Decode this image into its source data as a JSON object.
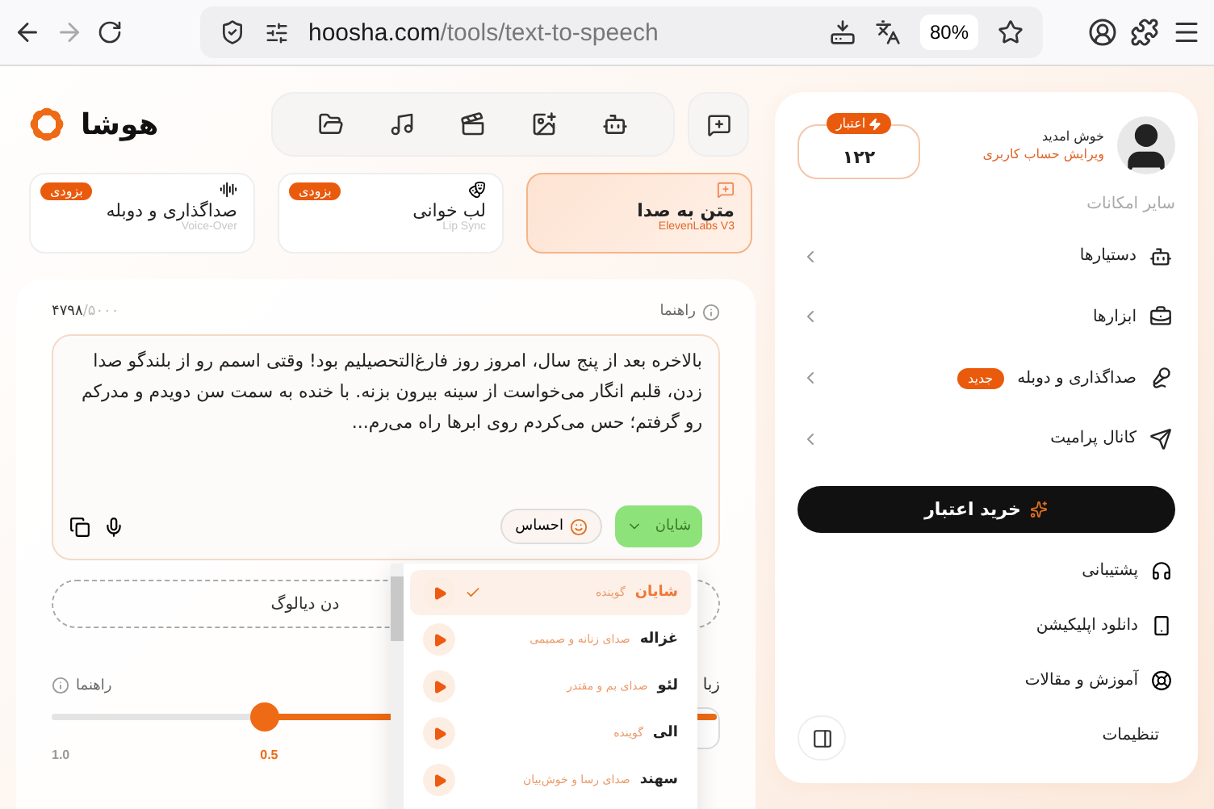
{
  "browser": {
    "url_host": "hoosha.com",
    "url_path": "/tools/text-to-speech",
    "zoom": "80%"
  },
  "logo": {
    "text": "هوشا"
  },
  "mode_cards": [
    {
      "title": "متن به صدا",
      "subtitle": "ElevenLabs V3",
      "selected": true
    },
    {
      "title": "لب خوانی",
      "subtitle": "Lip Sync",
      "badge": "بزودی",
      "selected": false
    },
    {
      "title": "صداگذاری و دوبله",
      "subtitle": "Voice-Over",
      "badge": "بزودی",
      "selected": false
    }
  ],
  "editor": {
    "guide": "راهنما",
    "counter_used": "۴۷۹۸",
    "counter_max": "/۵۰۰۰",
    "text": "بالاخره بعد از پنج سال، امروز روز فارغ‌التحصیلیم بود! وقتی اسمم رو از بلندگو صدا زدن، قلبم انگار می‌خواست از سینه بیرون بزنه. با خنده به سمت سن دویدم و مدرکم رو گرفتم؛ حس می‌کردم روی ابرها راه می‌رم...",
    "voice": "شایان",
    "emotion": "احساس"
  },
  "add_dialog": "دن دیالوگ",
  "speed": {
    "guide": "راهنما",
    "level": 0.68,
    "max_label": "1.0",
    "value_label": "0.5"
  },
  "language_label": "زبا",
  "voice_dropdown": [
    {
      "name": "شایان",
      "description": "گوینده",
      "selected": true
    },
    {
      "name": "غزاله",
      "description": "صدای زنانه و صمیمی",
      "selected": false
    },
    {
      "name": "لئو",
      "description": "صدای بم و مقتدر",
      "selected": false
    },
    {
      "name": "الی",
      "description": "گوینده",
      "selected": false
    },
    {
      "name": "سهند",
      "description": "صدای رسا و خوش‌بیان",
      "selected": false
    }
  ],
  "sidebar": {
    "greeting": "خوش امدید",
    "edit_profile": "ویرایش حساب کاربری",
    "credit_label": "اعتبار",
    "credit_value": "۱۲۲",
    "section_title": "سایر امکانات",
    "menu": [
      {
        "label": "دستیارها"
      },
      {
        "label": "ابزارها"
      },
      {
        "label": "صداگذاری و دوبله",
        "badge": "جدید"
      },
      {
        "label": "کانال پرامیت"
      }
    ],
    "buy_button": "خرید اعتبار",
    "links": [
      {
        "label": "پشتیبانی"
      },
      {
        "label": "دانلود اپلیکیشن"
      },
      {
        "label": "آموزش و مقالات"
      },
      {
        "label": "تنظیمات"
      }
    ]
  }
}
